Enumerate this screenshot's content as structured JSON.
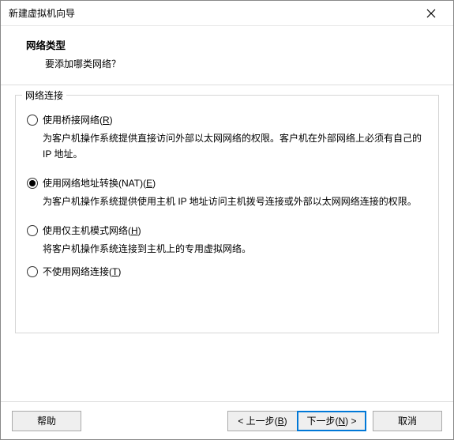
{
  "window": {
    "title": "新建虚拟机向导"
  },
  "header": {
    "title": "网络类型",
    "subtitle": "要添加哪类网络？"
  },
  "group": {
    "legend": "网络连接",
    "options": [
      {
        "label_pre": "使用桥接网络(",
        "accel": "R",
        "label_post": ")",
        "desc": "为客户机操作系统提供直接访问外部以太网网络的权限。客户机在外部网络上必须有自己的 IP 地址。",
        "selected": false
      },
      {
        "label_pre": "使用网络地址转换(NAT)(",
        "accel": "E",
        "label_post": ")",
        "desc": "为客户机操作系统提供使用主机 IP 地址访问主机拨号连接或外部以太网网络连接的权限。",
        "selected": true
      },
      {
        "label_pre": "使用仅主机模式网络(",
        "accel": "H",
        "label_post": ")",
        "desc": "将客户机操作系统连接到主机上的专用虚拟网络。",
        "selected": false
      },
      {
        "label_pre": "不使用网络连接(",
        "accel": "T",
        "label_post": ")",
        "desc": "",
        "selected": false
      }
    ]
  },
  "footer": {
    "help": "帮助",
    "back_pre": "< 上一步(",
    "back_accel": "B",
    "back_post": ")",
    "next_pre": "下一步(",
    "next_accel": "N",
    "next_post": ") >",
    "cancel": "取消"
  }
}
